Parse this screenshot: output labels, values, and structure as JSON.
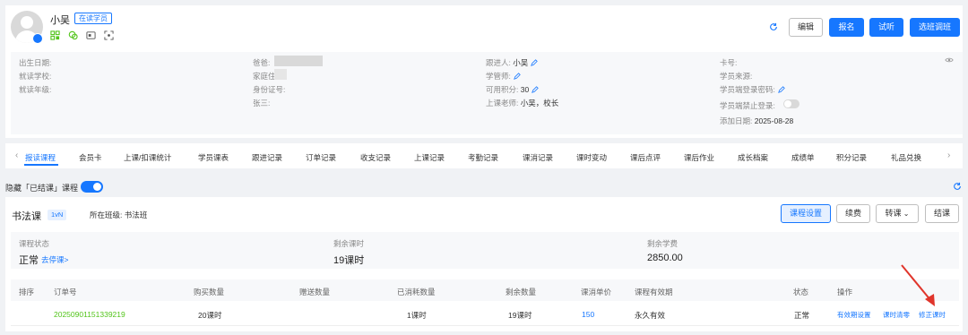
{
  "student": {
    "name": "小吴",
    "status": "在读学员"
  },
  "header_buttons": {
    "edit": "编辑",
    "enroll": "报名",
    "trial": "试听",
    "transfer": "选班调班"
  },
  "info": {
    "col1": [
      "出生日期:",
      "就读学校:",
      "就读年级:"
    ],
    "col2": [
      "爸爸:",
      "家庭住址:",
      "身份证号:",
      "张三:"
    ],
    "follower_label": "跟进人:",
    "follower_value": "小吴",
    "manager_label": "学管师:",
    "points_label": "可用积分:",
    "points_value": "30",
    "teacher_label": "上课老师:",
    "teacher_value": "小吴，校长",
    "card_label": "卡号:",
    "source_label": "学员来源:",
    "login_pwd_label": "学员端登录密码:",
    "login_ban_label": "学员端禁止登录:",
    "added_label": "添加日期:",
    "added_value": "2025-08-28"
  },
  "tabs": [
    "报读课程",
    "会员卡",
    "上课/扣课统计",
    "学员课表",
    "跟进记录",
    "订单记录",
    "收支记录",
    "上课记录",
    "考勤记录",
    "课消记录",
    "课时变动",
    "课后点评",
    "课后作业",
    "成长档案",
    "成绩单",
    "积分记录",
    "礼品兑换"
  ],
  "hide_finished_label": "隐藏「已结课」课程",
  "course": {
    "name": "书法课",
    "type_badge": "1vN",
    "class_label": "所在班级: 书法班",
    "buttons": {
      "settings": "课程设置",
      "renew": "续费",
      "transfer": "转课",
      "finish": "结课"
    },
    "stats": {
      "status_label": "课程状态",
      "status_value": "正常",
      "stop_link": "去停课>",
      "remaining_label": "剩余课时",
      "remaining_value": "19课时",
      "tuition_label": "剩余学费",
      "tuition_value": "2850.00"
    }
  },
  "table": {
    "headers": [
      "排序",
      "订单号",
      "购买数量",
      "赠送数量",
      "已消耗数量",
      "剩余数量",
      "课消单价",
      "课程有效期",
      "状态",
      "操作"
    ],
    "row": {
      "order_no": "20250901151339219",
      "bought": "20课时",
      "gift": "",
      "consumed": "1课时",
      "remaining": "19课时",
      "unit_price": "150",
      "validity": "永久有效",
      "status": "正常",
      "actions": [
        "有效期设置",
        "课时清零",
        "修正课时"
      ]
    }
  },
  "colors": {
    "primary": "#1677ff",
    "order_green": "#52c41a",
    "arrow_red": "#e0352b"
  }
}
